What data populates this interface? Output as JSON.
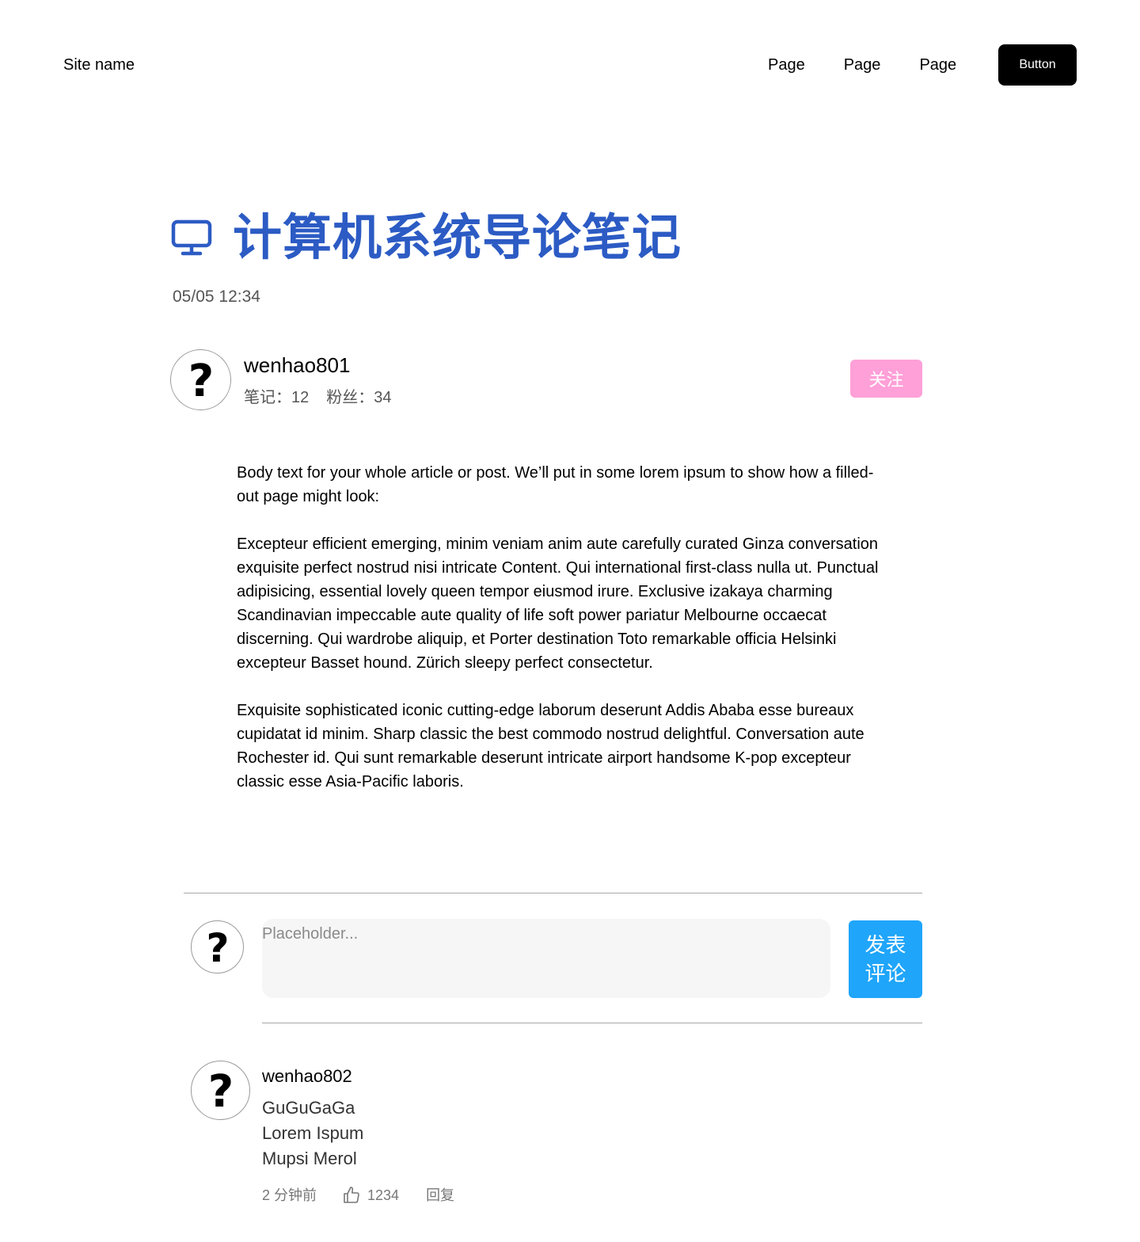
{
  "header": {
    "site_name": "Site name",
    "nav": [
      "Page",
      "Page",
      "Page"
    ],
    "button_label": "Button"
  },
  "article": {
    "icon": "monitor-icon",
    "title": "计算机系统导论笔记",
    "date": "05/05 12:34",
    "title_color": "#2c5bc4",
    "author": {
      "name": "wenhao801",
      "avatar_icon": "question-mark-icon",
      "stats": {
        "notes": "笔记：12",
        "followers": "粉丝：34"
      },
      "follow_label": "关注",
      "follow_color": "#ffa0d8"
    },
    "body": [
      "Body text for your whole article or post. We’ll put in some lorem ipsum to show how a filled-out page might look:",
      "Excepteur efficient emerging, minim veniam anim aute carefully curated Ginza conversation exquisite perfect nostrud nisi intricate Content. Qui  international first-class nulla ut. Punctual adipisicing, essential lovely queen tempor eiusmod irure. Exclusive izakaya charming Scandinavian impeccable aute quality of life soft power pariatur Melbourne occaecat discerning. Qui wardrobe aliquip, et Porter destination Toto remarkable officia Helsinki excepteur Basset hound. Zürich sleepy perfect consectetur.",
      "Exquisite sophisticated iconic cutting-edge laborum deserunt Addis Ababa esse bureaux cupidatat id minim. Sharp classic the best commodo nostrud delightful. Conversation aute Rochester id. Qui sunt remarkable deserunt intricate airport handsome K-pop excepteur classic esse Asia-Pacific laboris."
    ]
  },
  "composer": {
    "avatar_icon": "question-mark-icon",
    "placeholder": "Placeholder...",
    "value": "",
    "submit_label": "发表评论",
    "submit_color": "#1fa5fa"
  },
  "comments": [
    {
      "author": "wenhao802",
      "avatar_icon": "question-mark-icon",
      "lines": [
        "GuGuGaGa",
        "Lorem Ispum",
        "Mupsi Merol"
      ],
      "time": "2 分钟前",
      "like_icon": "thumbs-up-icon",
      "likes": "1234",
      "reply_label": "回复"
    }
  ]
}
